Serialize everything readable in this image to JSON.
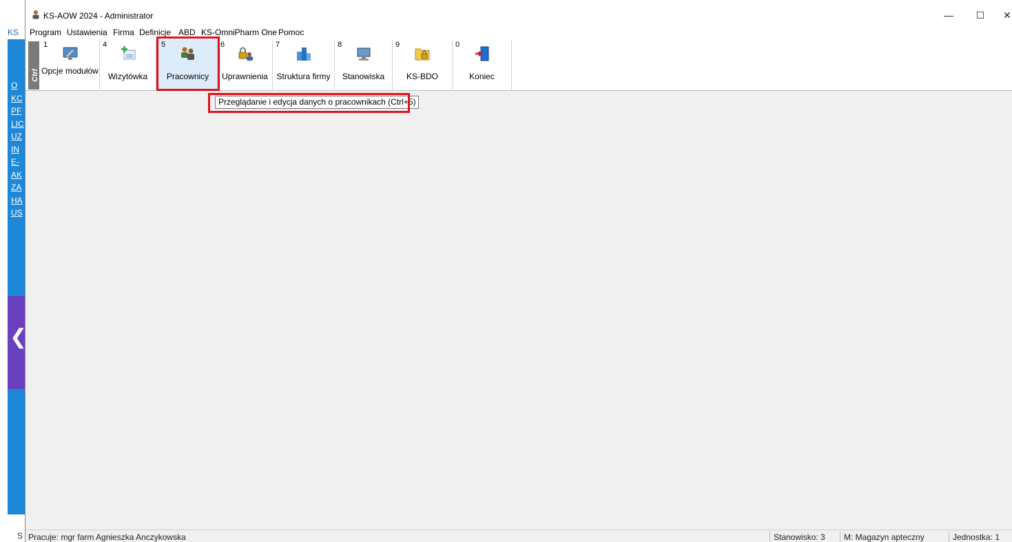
{
  "background_app": {
    "title": "KS",
    "sidebar_letters": [
      "O",
      "KC",
      "PF",
      "LIC",
      "UZ",
      "IN",
      "E-",
      "AK",
      "ZA",
      "HA",
      "US"
    ],
    "status": "S"
  },
  "window": {
    "title": "KS-AOW 2024 - Administrator",
    "controls": {
      "minimize": "—",
      "maximize": "☐",
      "close": "✕"
    }
  },
  "menu": [
    "Program",
    "Ustawienia",
    "Firma",
    "Definicje",
    "ABD",
    "KS-OmniPharm One",
    "Pomoc"
  ],
  "toolbar": {
    "ctrl_label": "Ctrl",
    "buttons": [
      {
        "key": "1",
        "label": "Opcje modułów",
        "icon": "module-options-icon"
      },
      {
        "key": "4",
        "label": "Wizytówka",
        "icon": "business-card-icon"
      },
      {
        "key": "5",
        "label": "Pracownicy",
        "icon": "employees-icon"
      },
      {
        "key": "6",
        "label": "Uprawnienia",
        "icon": "permissions-icon"
      },
      {
        "key": "7",
        "label": "Struktura firmy",
        "icon": "company-structure-icon"
      },
      {
        "key": "8",
        "label": "Stanowiska",
        "icon": "workstations-icon"
      },
      {
        "key": "9",
        "label": "KS-BDO",
        "icon": "bdo-folder-icon"
      },
      {
        "key": "0",
        "label": "Koniec",
        "icon": "exit-door-icon"
      }
    ]
  },
  "tooltip": "Przeglądanie i edycja danych o pracownikach (Ctrl+5)",
  "status": {
    "user": "Pracuje: mgr farm Agnieszka Anczykowska",
    "station": "Stanowisko: 3",
    "warehouse": "M: Magazyn apteczny",
    "unit": "Jednostka: 1"
  },
  "colors": {
    "highlight": "#e0101a",
    "active_button": "#dcecfb",
    "accent_blue": "#1e88d8"
  }
}
